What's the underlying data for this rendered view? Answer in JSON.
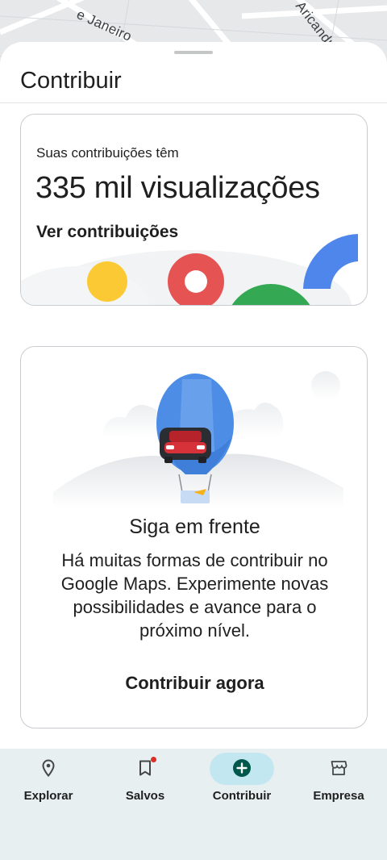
{
  "map": {
    "street_labels": [
      "e Janeiro",
      "Aricandu"
    ]
  },
  "sheet": {
    "title": "Contribuir"
  },
  "stats_card": {
    "subtitle": "Suas contribuições têm",
    "headline": "335 mil visualizações",
    "link_label": "Ver contribuições"
  },
  "encourage_card": {
    "title": "Siga em frente",
    "body": "Há muitas formas de contribuir no Google Maps. Experimente novas possibilidades e avance para o próximo nível.",
    "cta_label": "Contribuir agora"
  },
  "bottom_nav": {
    "items": [
      {
        "label": "Explorar",
        "icon": "location-pin-icon"
      },
      {
        "label": "Salvos",
        "icon": "bookmark-icon"
      },
      {
        "label": "Contribuir",
        "icon": "add-circle-icon"
      },
      {
        "label": "Empresa",
        "icon": "storefront-icon"
      }
    ],
    "active_index": 2
  },
  "colors": {
    "brand_blue": "#4285f4",
    "brand_red": "#ea4335",
    "brand_yellow": "#fbbc04",
    "brand_green": "#34a853",
    "nav_active_pill": "#c3e7f0",
    "contribute_icon": "#00574b",
    "badge_red": "#d93025"
  }
}
